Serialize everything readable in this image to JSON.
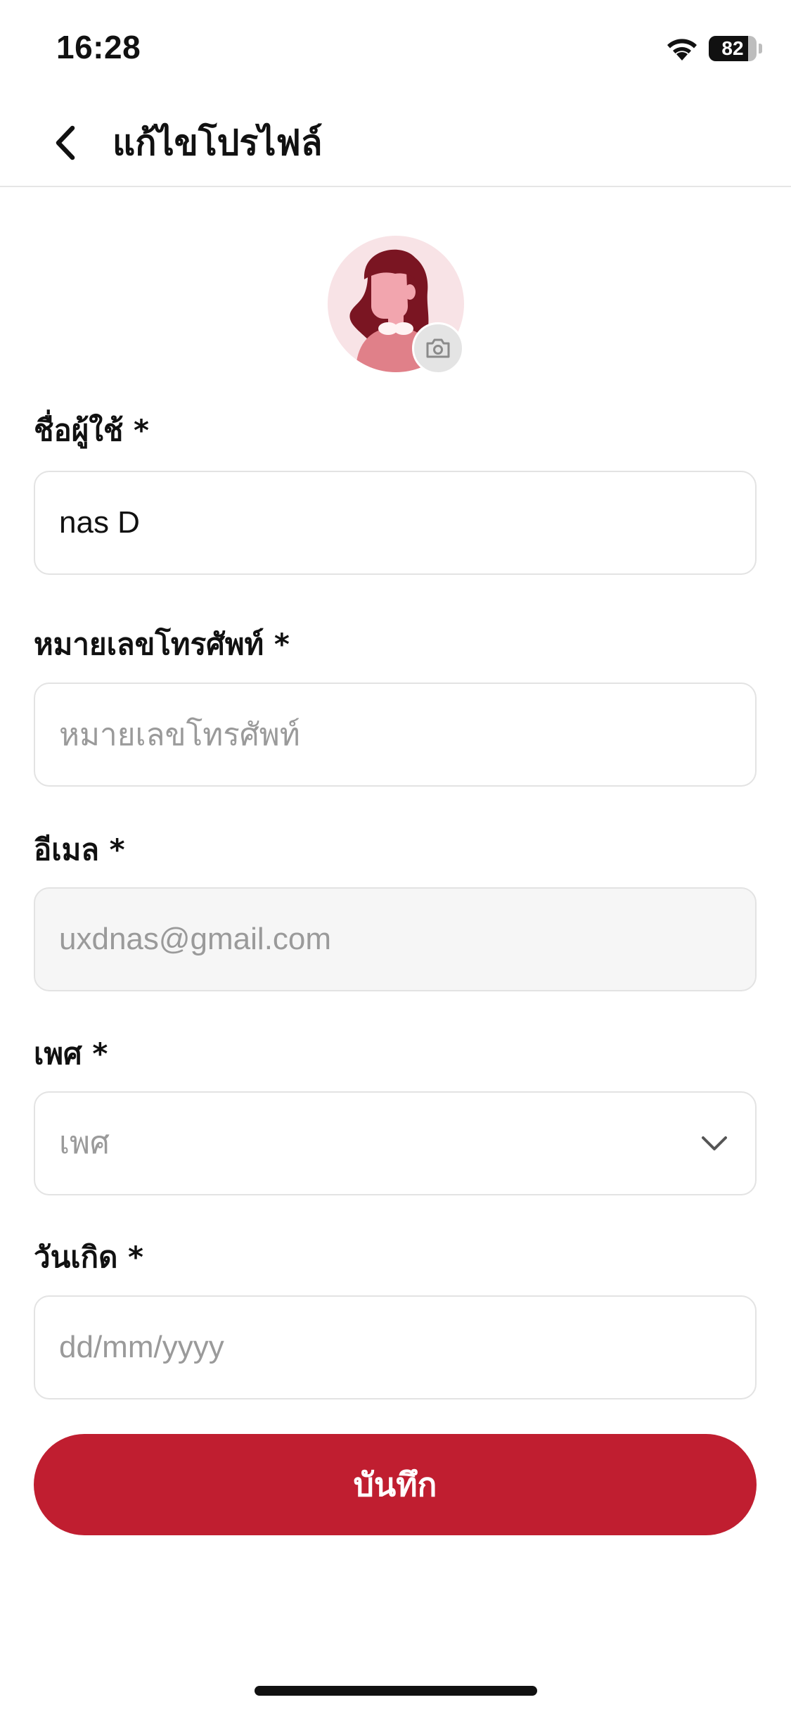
{
  "status_bar": {
    "time": "16:28",
    "battery_percent": "82",
    "battery_level": 0.82
  },
  "header": {
    "title": "แก้ไขโปรไฟล์"
  },
  "avatar": {
    "icon": "camera-icon"
  },
  "form": {
    "username": {
      "label": "ชื่อผู้ใช้ *",
      "value": "nas D",
      "placeholder": ""
    },
    "phone": {
      "label": "หมายเลขโทรศัพท์ *",
      "value": "",
      "placeholder": "หมายเลขโทรศัพท์"
    },
    "email": {
      "label": "อีเมล *",
      "value": "uxdnas@gmail.com",
      "placeholder": ""
    },
    "gender": {
      "label": "เพศ *",
      "selected": "เพศ"
    },
    "birthday": {
      "label": "วันเกิด *",
      "value": "",
      "placeholder": "dd/mm/yyyy"
    }
  },
  "actions": {
    "save_label": "บันทึก"
  },
  "colors": {
    "primary": "#c01e30",
    "avatar_bg": "#f8e3e6",
    "hair": "#7a1522"
  }
}
